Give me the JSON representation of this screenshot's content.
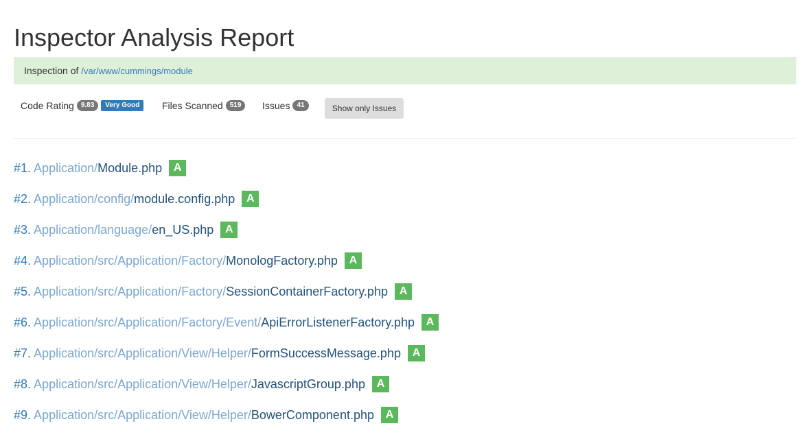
{
  "page": {
    "title": "Inspector Analysis Report"
  },
  "inspection": {
    "prefix": "Inspection of",
    "path": "/var/www/cummings/module"
  },
  "stats": {
    "code_rating_label": "Code Rating",
    "code_rating_value": "9.83",
    "code_rating_grade": "Very Good",
    "files_scanned_label": "Files Scanned",
    "files_scanned_value": "519",
    "issues_label": "Issues",
    "issues_value": "41",
    "show_issues_button": "Show only Issues"
  },
  "colors": {
    "alert_bg": "#dff0d8",
    "link": "#337ab7",
    "grade_green": "#5cb85c",
    "badge_gray": "#777777",
    "very_good_blue": "#337ab7"
  },
  "files": [
    {
      "num": "#1.",
      "dir": "Application/",
      "name": "Module.php",
      "grade": "A"
    },
    {
      "num": "#2.",
      "dir": "Application/config/",
      "name": "module.config.php",
      "grade": "A"
    },
    {
      "num": "#3.",
      "dir": "Application/language/",
      "name": "en_US.php",
      "grade": "A"
    },
    {
      "num": "#4.",
      "dir": "Application/src/Application/Factory/",
      "name": "MonologFactory.php",
      "grade": "A"
    },
    {
      "num": "#5.",
      "dir": "Application/src/Application/Factory/",
      "name": "SessionContainerFactory.php",
      "grade": "A"
    },
    {
      "num": "#6.",
      "dir": "Application/src/Application/Factory/Event/",
      "name": "ApiErrorListenerFactory.php",
      "grade": "A"
    },
    {
      "num": "#7.",
      "dir": "Application/src/Application/View/Helper/",
      "name": "FormSuccessMessage.php",
      "grade": "A"
    },
    {
      "num": "#8.",
      "dir": "Application/src/Application/View/Helper/",
      "name": "JavascriptGroup.php",
      "grade": "A"
    },
    {
      "num": "#9.",
      "dir": "Application/src/Application/View/Helper/",
      "name": "BowerComponent.php",
      "grade": "A"
    }
  ]
}
